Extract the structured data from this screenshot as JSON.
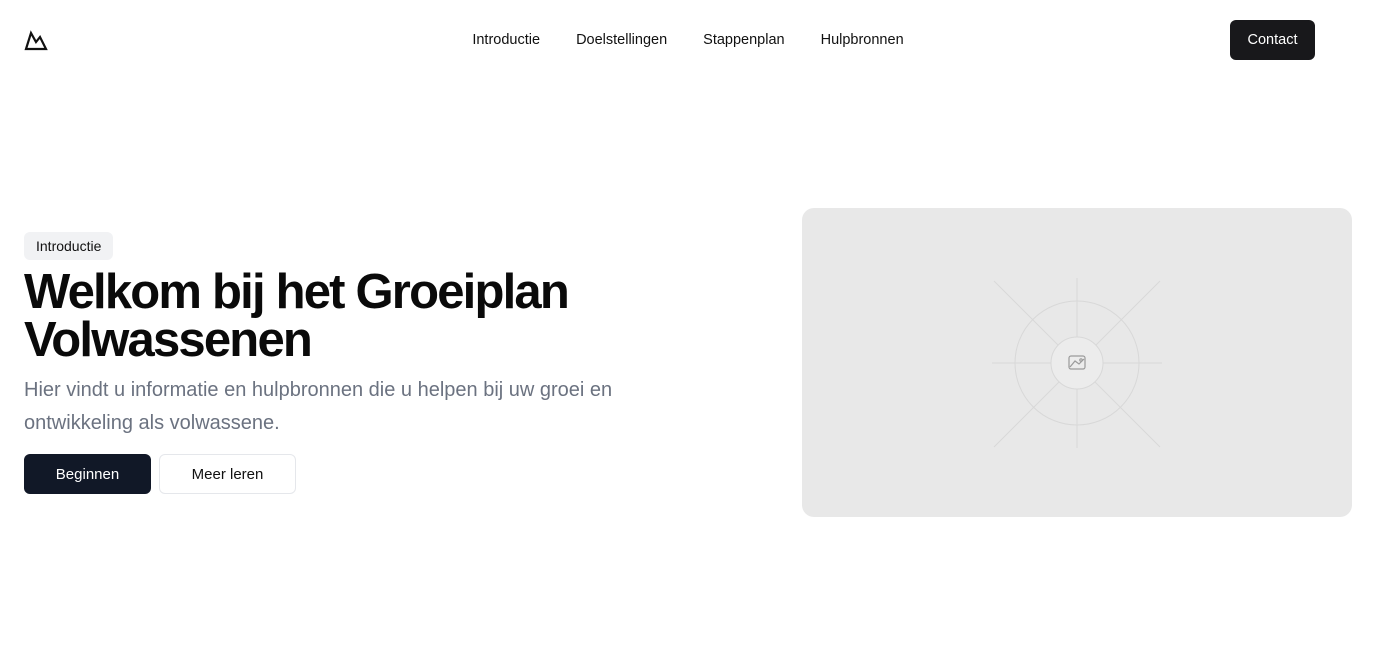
{
  "header": {
    "logo_icon": "mountain-logo-icon",
    "nav": [
      {
        "label": "Introductie"
      },
      {
        "label": "Doelstellingen"
      },
      {
        "label": "Stappenplan"
      },
      {
        "label": "Hulpbronnen"
      }
    ],
    "contact_label": "Contact"
  },
  "hero": {
    "badge": "Introductie",
    "title_line1": "Welkom bij het Groeiplan",
    "title_line2": "Volwassenen",
    "subtitle": "Hier vindt u informatie en hulpbronnen die u helpen bij uw groei en ontwikkeling als volwassene.",
    "primary_label": "Beginnen",
    "secondary_label": "Meer leren",
    "image_icon": "image-placeholder-icon"
  },
  "colors": {
    "primary": "#111827",
    "contact": "#18181b",
    "muted_text": "#6b7280",
    "placeholder_bg": "#e8e8e8"
  }
}
